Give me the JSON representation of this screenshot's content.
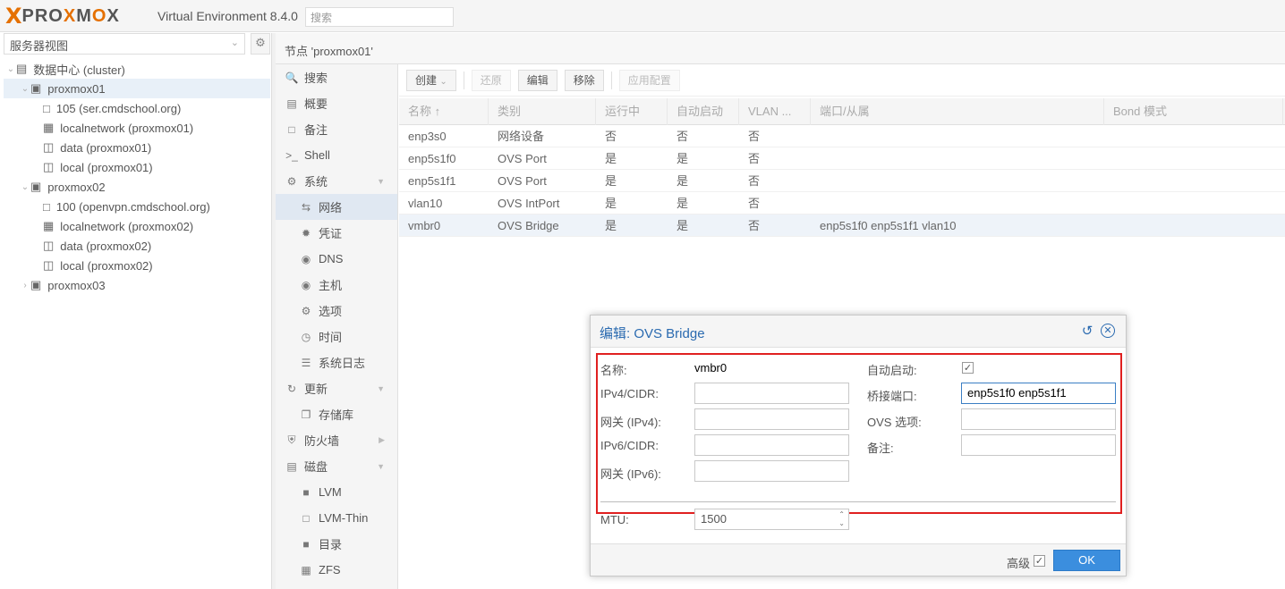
{
  "header": {
    "logo_prefix": "PRO",
    "logo_x": "X",
    "logo_mid": "M",
    "logo_o": "O",
    "logo_suffix": "X",
    "product": "Virtual Environment 8.4.0",
    "search_placeholder": "搜索"
  },
  "left": {
    "view_selector": "服务器视图",
    "tree": [
      {
        "label": "数据中心 (cluster)",
        "icon": "datacenter-icon",
        "level": 0
      },
      {
        "label": "proxmox01",
        "icon": "node-icon",
        "level": 1,
        "selected": true
      },
      {
        "label": "105 (ser.cmdschool.org)",
        "icon": "vm-icon",
        "level": 2
      },
      {
        "label": "localnetwork (proxmox01)",
        "icon": "network-icon",
        "level": 2
      },
      {
        "label": "data (proxmox01)",
        "icon": "storage-icon",
        "level": 2
      },
      {
        "label": "local (proxmox01)",
        "icon": "storage-icon",
        "level": 2
      },
      {
        "label": "proxmox02",
        "icon": "node-icon",
        "level": 1
      },
      {
        "label": "100 (openvpn.cmdschool.org)",
        "icon": "vm-icon",
        "level": 2
      },
      {
        "label": "localnetwork (proxmox02)",
        "icon": "network-icon",
        "level": 2
      },
      {
        "label": "data (proxmox02)",
        "icon": "storage-icon",
        "level": 2
      },
      {
        "label": "local (proxmox02)",
        "icon": "storage-icon",
        "level": 2
      },
      {
        "label": "proxmox03",
        "icon": "node-icon",
        "level": 1
      }
    ]
  },
  "breadcrumb": "节点 'proxmox01'",
  "nav": [
    {
      "label": "搜索",
      "icon": "search-icon",
      "sub": false
    },
    {
      "label": "概要",
      "icon": "book-icon",
      "sub": false
    },
    {
      "label": "备注",
      "icon": "note-icon",
      "sub": false
    },
    {
      "label": "Shell",
      "icon": "terminal-icon",
      "sub": false
    },
    {
      "label": "系统",
      "icon": "gears-icon",
      "sub": false,
      "expand": "down"
    },
    {
      "label": "网络",
      "icon": "exchange-icon",
      "sub": true,
      "selected": true
    },
    {
      "label": "凭证",
      "icon": "certificate-icon",
      "sub": true
    },
    {
      "label": "DNS",
      "icon": "globe-icon",
      "sub": true
    },
    {
      "label": "主机",
      "icon": "globe-icon",
      "sub": true
    },
    {
      "label": "选项",
      "icon": "gear-icon",
      "sub": true
    },
    {
      "label": "时间",
      "icon": "clock-icon",
      "sub": true
    },
    {
      "label": "系统日志",
      "icon": "list-icon",
      "sub": true
    },
    {
      "label": "更新",
      "icon": "refresh-icon",
      "sub": false,
      "expand": "down"
    },
    {
      "label": "存储库",
      "icon": "files-icon",
      "sub": true
    },
    {
      "label": "防火墙",
      "icon": "shield-icon",
      "sub": false,
      "expand": "right"
    },
    {
      "label": "磁盘",
      "icon": "hdd-icon",
      "sub": false,
      "expand": "down"
    },
    {
      "label": "LVM",
      "icon": "square-icon",
      "sub": true
    },
    {
      "label": "LVM-Thin",
      "icon": "square-outline-icon",
      "sub": true
    },
    {
      "label": "目录",
      "icon": "folder-icon",
      "sub": true
    },
    {
      "label": "ZFS",
      "icon": "grid-icon",
      "sub": true
    }
  ],
  "toolbar": {
    "create": "创建",
    "revert": "还原",
    "edit": "编辑",
    "remove": "移除",
    "apply": "应用配置"
  },
  "grid": {
    "columns": [
      "名称 ↑",
      "类别",
      "运行中",
      "自动启动",
      "VLAN ...",
      "端口/从属",
      "Bond 模式"
    ],
    "rows": [
      [
        "enp3s0",
        "网络设备",
        "否",
        "否",
        "否",
        "",
        ""
      ],
      [
        "enp5s1f0",
        "OVS Port",
        "是",
        "是",
        "否",
        "",
        ""
      ],
      [
        "enp5s1f1",
        "OVS Port",
        "是",
        "是",
        "否",
        "",
        ""
      ],
      [
        "vlan10",
        "OVS IntPort",
        "是",
        "是",
        "否",
        "",
        ""
      ],
      [
        "vmbr0",
        "OVS Bridge",
        "是",
        "是",
        "否",
        "enp5s1f0 enp5s1f1 vlan10",
        ""
      ]
    ]
  },
  "dialog": {
    "title": "编辑: OVS Bridge",
    "name_label": "名称:",
    "name_value": "vmbr0",
    "ipv4_label": "IPv4/CIDR:",
    "ipv4_value": "",
    "gw4_label": "网关 (IPv4):",
    "gw4_value": "",
    "ipv6_label": "IPv6/CIDR:",
    "ipv6_value": "",
    "gw6_label": "网关 (IPv6):",
    "gw6_value": "",
    "autostart_label": "自动启动:",
    "autostart_checked": true,
    "ports_label": "桥接端口:",
    "ports_value": "enp5s1f0 enp5s1f1",
    "ovs_label": "OVS 选项:",
    "ovs_value": "",
    "comment_label": "备注:",
    "comment_value": "",
    "mtu_label": "MTU:",
    "mtu_value": "1500",
    "advanced_label": "高级",
    "advanced_checked": true,
    "ok_label": "OK"
  },
  "colors": {
    "accent": "#3b8ede",
    "logo_orange": "#e57000",
    "highlight_red": "#e02020"
  }
}
